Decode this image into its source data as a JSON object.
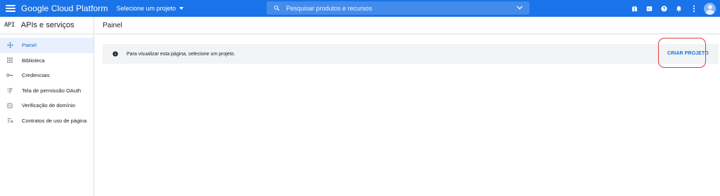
{
  "header": {
    "brand": "Google Cloud Platform",
    "project_selector": "Selecione um projeto",
    "search": {
      "placeholder": "Pesquisar produtos e recursos"
    },
    "icons": [
      "menu-icon",
      "caret-down-icon",
      "search-icon",
      "chevron-down-icon",
      "gift-icon",
      "terminal-icon",
      "help-icon",
      "bell-icon",
      "more-vert-icon",
      "avatar-icon"
    ]
  },
  "sidebar": {
    "logo": "API",
    "title": "APIs e serviços",
    "items": [
      {
        "label": "Painel",
        "icon": "dashboard-icon",
        "active": true
      },
      {
        "label": "Biblioteca",
        "icon": "grid-icon",
        "active": false
      },
      {
        "label": "Credenciais",
        "icon": "key-icon",
        "active": false
      },
      {
        "label": "Tela de permissão OAuth",
        "icon": "consent-list-icon",
        "active": false
      },
      {
        "label": "Verificação de domínio",
        "icon": "checkbox-icon",
        "active": false
      },
      {
        "label": "Contratos de uso de página",
        "icon": "settings-list-icon",
        "active": false
      }
    ]
  },
  "main": {
    "title": "Painel",
    "banner": {
      "icon": "info-icon",
      "message": "Para visualizar esta página, selecione um projeto.",
      "action": "CRIAR PROJETO"
    }
  },
  "colors": {
    "header_bg": "#1a73e8",
    "active_nav_bg": "#e8f0fe",
    "active_nav_text": "#1967d2",
    "banner_bg": "#f1f3f4",
    "action_text": "#1a73e8",
    "highlight_ring": "#e53935"
  }
}
